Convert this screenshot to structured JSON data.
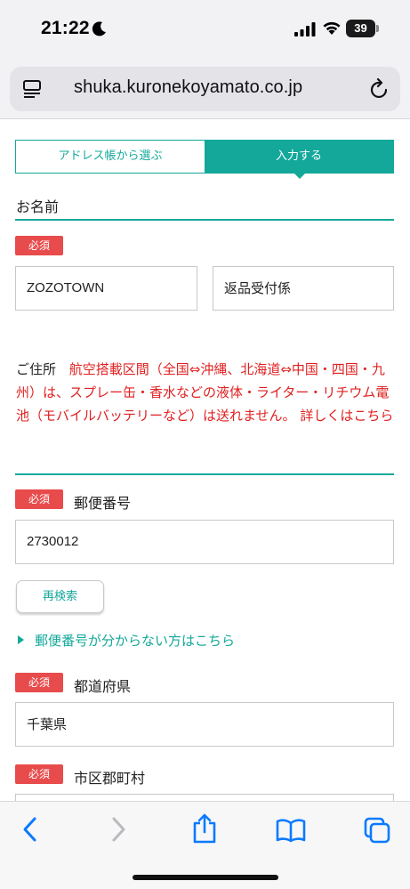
{
  "status_bar": {
    "time": "21:22",
    "battery_level": "39"
  },
  "browser": {
    "url": "shuka.kuronekoyamato.co.jp"
  },
  "tabs": {
    "address_book": "アドレス帳から選ぶ",
    "enter": "入力する",
    "active": "enter"
  },
  "name_section": {
    "title": "お名前",
    "required_badge": "必須",
    "last_name_value": "ZOZOTOWN",
    "first_name_value": "返品受付係"
  },
  "address_section": {
    "title": "ご住所",
    "warning": "航空搭載区間（全国⇔沖縄、北海道⇔中国・四国・九州）は、スプレー缶・香水などの液体・ライター・リチウム電池（モバイルバッテリーなど）は送れません。 詳しくはこちら"
  },
  "postal": {
    "required_badge": "必須",
    "label": "郵便番号",
    "value": "2730012",
    "search_button": "再検索",
    "help_link": "郵便番号が分からない方はこちら"
  },
  "prefecture": {
    "required_badge": "必須",
    "label": "都道府県",
    "value": "千葉県"
  },
  "city": {
    "required_badge": "必須",
    "label": "市区郡町村"
  },
  "colors": {
    "accent": "#13a89a",
    "required": "#e84b4b",
    "warning_text": "#e02020",
    "ios_blue": "#0a7aff"
  }
}
